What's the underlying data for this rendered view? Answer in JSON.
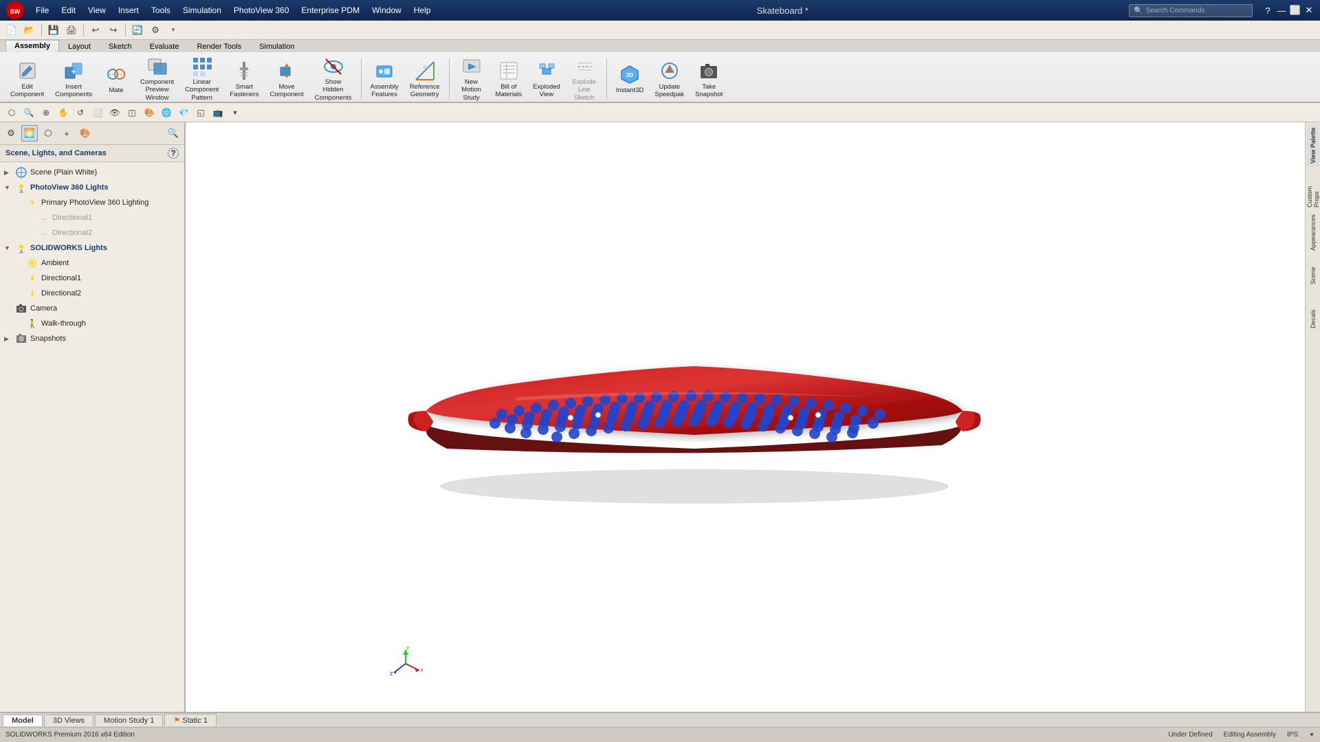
{
  "titlebar": {
    "logo": "SW",
    "menu": [
      "File",
      "Edit",
      "View",
      "Insert",
      "Tools",
      "Simulation",
      "PhotoView 360",
      "Enterprise PDM",
      "Window",
      "Help"
    ],
    "title": "Skateboard *",
    "search_placeholder": "Search Commands",
    "window_controls": [
      "—",
      "☐",
      "✕"
    ]
  },
  "ribbon": {
    "tabs": [
      "Assembly",
      "Layout",
      "Sketch",
      "Evaluate",
      "Render Tools",
      "Simulation"
    ],
    "active_tab": "Assembly",
    "buttons": [
      {
        "label": "Edit\nComponent",
        "icon": "✏️",
        "id": "edit-component"
      },
      {
        "label": "Insert\nComponents",
        "icon": "📦",
        "id": "insert-components"
      },
      {
        "label": "Mate",
        "icon": "🔗",
        "id": "mate"
      },
      {
        "label": "Component\nPreview\nWindow",
        "icon": "🪟",
        "id": "component-preview"
      },
      {
        "label": "Linear\nComponent\nPattern",
        "icon": "⠿",
        "id": "linear-component-pattern"
      },
      {
        "label": "Smart\nFasteners",
        "icon": "🔩",
        "id": "smart-fasteners"
      },
      {
        "label": "Move\nComponent",
        "icon": "↕",
        "id": "move-component"
      },
      {
        "label": "Show\nHidden\nComponents",
        "icon": "👁",
        "id": "show-hidden"
      },
      {
        "label": "Assembly\nFeatures",
        "icon": "⚙",
        "id": "assembly-features"
      },
      {
        "label": "Reference\nGeometry",
        "icon": "📐",
        "id": "reference-geometry"
      },
      {
        "label": "New\nMotion\nStudy",
        "icon": "🎬",
        "id": "new-motion-study"
      },
      {
        "label": "Bill of\nMaterials",
        "icon": "📋",
        "id": "bill-of-materials"
      },
      {
        "label": "Exploded\nView",
        "icon": "💥",
        "id": "exploded-view"
      },
      {
        "label": "Explode\nLine\nSketch",
        "icon": "✏",
        "id": "explode-line-sketch"
      },
      {
        "label": "Instant3D",
        "icon": "3D",
        "id": "instant3d"
      },
      {
        "label": "Update\nSpeedpak",
        "icon": "⚡",
        "id": "update-speedpak"
      },
      {
        "label": "Take\nSnapshot",
        "icon": "📷",
        "id": "take-snapshot"
      }
    ]
  },
  "panel": {
    "header": "Scene, Lights, and Cameras",
    "help_icon": "?",
    "tree": [
      {
        "level": 0,
        "label": "Scene (Plain White)",
        "icon": "🌐",
        "arrow": "▶"
      },
      {
        "level": 0,
        "label": "PhotoView 360 Lights",
        "icon": "💡",
        "arrow": "▼",
        "expanded": true
      },
      {
        "level": 1,
        "label": "Primary PhotoView 360 Lighting",
        "icon": "☀",
        "arrow": ""
      },
      {
        "level": 2,
        "label": "Directional1",
        "icon": "→",
        "arrow": ""
      },
      {
        "level": 2,
        "label": "Directional2",
        "icon": "→",
        "arrow": ""
      },
      {
        "level": 0,
        "label": "SOLIDWORKS Lights",
        "icon": "💡",
        "arrow": "▼",
        "expanded": true
      },
      {
        "level": 1,
        "label": "Ambient",
        "icon": "○",
        "arrow": ""
      },
      {
        "level": 1,
        "label": "Directional1",
        "icon": "→",
        "arrow": ""
      },
      {
        "level": 1,
        "label": "Directional2",
        "icon": "→",
        "arrow": ""
      },
      {
        "level": 0,
        "label": "Camera",
        "icon": "📷",
        "arrow": ""
      },
      {
        "level": 1,
        "label": "Walk-through",
        "icon": "🚶",
        "arrow": ""
      },
      {
        "level": 0,
        "label": "Snapshots",
        "icon": "📸",
        "arrow": "▶"
      }
    ]
  },
  "bottom_tabs": [
    {
      "label": "Model",
      "icon": ""
    },
    {
      "label": "3D Views",
      "icon": ""
    },
    {
      "label": "Motion Study 1",
      "icon": ""
    },
    {
      "label": "Static 1",
      "icon": "⚑"
    }
  ],
  "active_bottom_tab": "Model",
  "statusbar": {
    "left": "SOLIDWORKS Premium 2016 x64 Edition",
    "status": "Under Defined",
    "mode": "Editing Assembly",
    "units": "IPS"
  },
  "viewport": {
    "bg": "#ffffff"
  },
  "icons": {
    "search": "🔍",
    "gear": "⚙",
    "arrow_down": "▼",
    "close": "✕",
    "minimize": "—",
    "restore": "☐"
  }
}
